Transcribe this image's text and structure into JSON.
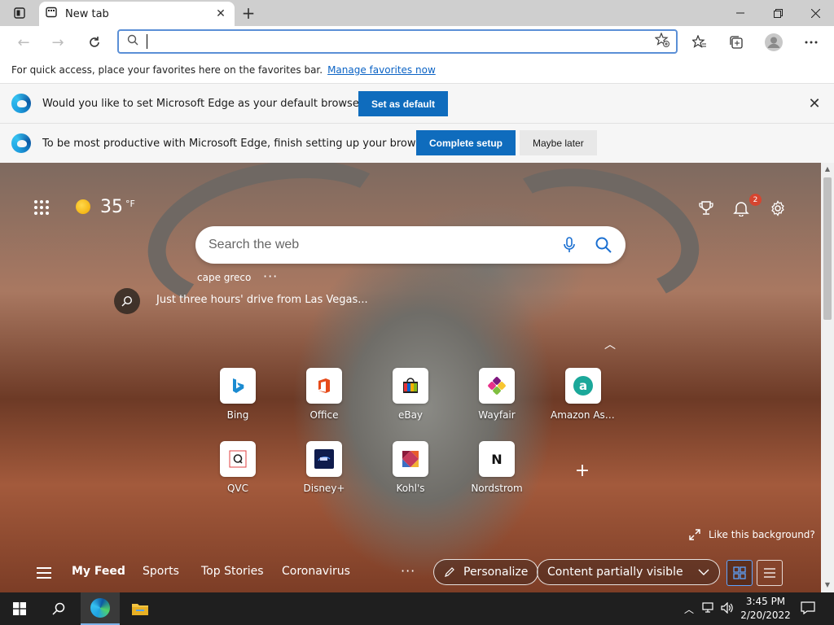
{
  "window": {
    "tab_title": "New tab"
  },
  "toolbar": {
    "address_value": ""
  },
  "favorites_bar": {
    "message": "For quick access, place your favorites here on the favorites bar.",
    "link": "Manage favorites now"
  },
  "default_bar": {
    "message": "Would you like to set Microsoft Edge as your default browser?",
    "button": "Set as default"
  },
  "setup_bar": {
    "message": "To be most productive with Microsoft Edge, finish setting up your browser.",
    "primary_button": "Complete setup",
    "secondary_button": "Maybe later"
  },
  "weather": {
    "temperature": "35",
    "unit": "°F"
  },
  "notifications": {
    "count": "2"
  },
  "search": {
    "placeholder": "Search the web"
  },
  "trending": {
    "term": "cape greco",
    "story": "Just three hours' drive from Las Vegas..."
  },
  "quick_links": [
    {
      "label": "Bing",
      "icon": "bing-icon"
    },
    {
      "label": "Office",
      "icon": "office-icon"
    },
    {
      "label": "eBay",
      "icon": "ebay-icon"
    },
    {
      "label": "Wayfair",
      "icon": "wayfair-icon"
    },
    {
      "label": "Amazon Assi...",
      "icon": "amazon-icon"
    },
    {
      "label": "QVC",
      "icon": "qvc-icon"
    },
    {
      "label": "Disney+",
      "icon": "disney-plus-icon"
    },
    {
      "label": "Kohl's",
      "icon": "kohls-icon"
    },
    {
      "label": "Nordstrom",
      "icon": "nordstrom-icon"
    }
  ],
  "background": {
    "like_label": "Like this background?"
  },
  "feed": {
    "items": [
      "My Feed",
      "Sports",
      "Top Stories",
      "Coronavirus"
    ],
    "personalize": "Personalize",
    "visibility": "Content partially visible"
  },
  "taskbar": {
    "time": "3:45 PM",
    "date": "2/20/2022"
  },
  "colors": {
    "accent": "#0f6cbd",
    "badge": "#d64530",
    "link": "#0b63c5"
  }
}
